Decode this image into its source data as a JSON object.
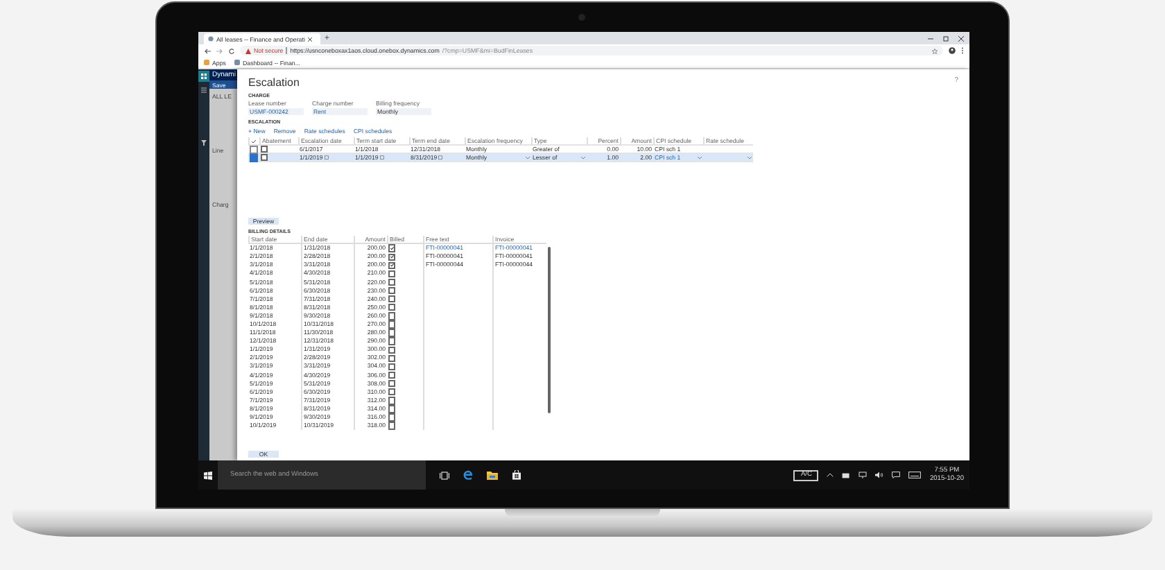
{
  "browser": {
    "tab_title": "All leases -- Finance and Operati",
    "new_tab": "+",
    "security": "Not secure",
    "url_host": "https://usnconeboxax1aos.cloud.onebox.dynamics.com",
    "url_path": "/?cmp=USMF&mi=BudFinLeases",
    "bookmarks": [
      "Apps",
      "Dashboard -- Finan..."
    ]
  },
  "app": {
    "brand": "Dynami",
    "save": "Save",
    "background_labels": [
      "ALL LE",
      "Line",
      "Charg"
    ]
  },
  "dialog": {
    "title": "Escalation",
    "help": "?",
    "charge_heading": "CHARGE",
    "fields": [
      {
        "label": "Lease number",
        "value": "USMF-000242"
      },
      {
        "label": "Charge number",
        "value": "Rent"
      },
      {
        "label": "Billing frequency",
        "value": "Monthly"
      }
    ],
    "escalation_heading": "ESCALATION",
    "actions": [
      "+ New",
      "Remove",
      "Rate schedules",
      "CPI schedules"
    ],
    "escalation_table": {
      "columns": [
        {
          "label": "Abatement",
          "kind": "check"
        },
        {
          "label": "Escalation date",
          "kind": "date"
        },
        {
          "label": "Term start date",
          "kind": "date"
        },
        {
          "label": "Term end date",
          "kind": "date"
        },
        {
          "label": "Escalation frequency",
          "kind": "choice"
        },
        {
          "label": "Type",
          "kind": "choice"
        },
        {
          "label": "Percent",
          "kind": "number"
        },
        {
          "label": "Amount",
          "kind": "number"
        },
        {
          "label": "CPI schedule",
          "kind": "choice"
        },
        {
          "label": "Rate schedule",
          "kind": "choice"
        }
      ],
      "rows": [
        {
          "selected": false,
          "abatement": false,
          "cells": [
            "",
            "6/1/2017",
            "1/1/2018",
            "12/31/2018",
            "Monthly",
            "Greater of",
            "0.00",
            "10.00",
            "CPI sch 1"
          ]
        },
        {
          "selected": true,
          "abatement": false,
          "cells": [
            "",
            "1/1/2019",
            "1/1/2019",
            "8/31/2019",
            "Monthly",
            "Lesser of",
            "1.00",
            "2.00",
            "CPI sch 1"
          ]
        }
      ]
    },
    "preview": "Preview",
    "billing_heading": "BILLING DETAILS",
    "billing_table": {
      "columns": [
        "Start date",
        "End date",
        "Amount",
        "Billed",
        "Free text",
        "Invoice"
      ],
      "rows": [
        {
          "cells": [
            "1/1/2018",
            "1/31/2018",
            "200.00"
          ],
          "billed": true,
          "free_text": "FTI-00000041",
          "invoice": "FTI-00000041"
        },
        {
          "cells": [
            "2/1/2018",
            "2/28/2018",
            "200.00"
          ],
          "billed": true,
          "free_text": "FTI-00000041",
          "invoice": "FTI-00000041"
        },
        {
          "cells": [
            "3/1/2018",
            "3/31/2018",
            "200.00"
          ],
          "billed": true,
          "free_text": "FTI-00000044",
          "invoice": "FTI-00000044"
        },
        {
          "cells": [
            "4/1/2018",
            "4/30/2018",
            "210.00"
          ],
          "billed": false
        },
        {
          "cells": [
            "5/1/2018",
            "5/31/2018",
            "220.00"
          ],
          "billed": false
        },
        {
          "cells": [
            "6/1/2018",
            "6/30/2018",
            "230.00"
          ],
          "billed": false
        },
        {
          "cells": [
            "7/1/2018",
            "7/31/2018",
            "240.00"
          ],
          "billed": false
        },
        {
          "cells": [
            "8/1/2018",
            "8/31/2018",
            "250.00"
          ],
          "billed": false
        },
        {
          "cells": [
            "9/1/2018",
            "9/30/2018",
            "260.00"
          ],
          "billed": false
        },
        {
          "cells": [
            "10/1/2018",
            "10/31/2018",
            "270.00"
          ],
          "billed": false
        },
        {
          "cells": [
            "11/1/2018",
            "11/30/2018",
            "280.00"
          ],
          "billed": false
        },
        {
          "cells": [
            "12/1/2018",
            "12/31/2018",
            "290.00"
          ],
          "billed": false
        },
        {
          "cells": [
            "1/1/2019",
            "1/31/2019",
            "300.00"
          ],
          "billed": false
        },
        {
          "cells": [
            "2/1/2019",
            "2/28/2019",
            "302.00"
          ],
          "billed": false
        },
        {
          "cells": [
            "3/1/2019",
            "3/31/2019",
            "304.00"
          ],
          "billed": false
        },
        {
          "cells": [
            "4/1/2019",
            "4/30/2019",
            "306.00"
          ],
          "billed": false
        },
        {
          "cells": [
            "5/1/2019",
            "5/31/2019",
            "308.00"
          ],
          "billed": false
        },
        {
          "cells": [
            "6/1/2019",
            "6/30/2019",
            "310.00"
          ],
          "billed": false
        },
        {
          "cells": [
            "7/1/2019",
            "7/31/2019",
            "312.00"
          ],
          "billed": false
        },
        {
          "cells": [
            "8/1/2019",
            "8/31/2019",
            "314.00"
          ],
          "billed": false
        },
        {
          "cells": [
            "9/1/2019",
            "9/30/2019",
            "316.00"
          ],
          "billed": false
        },
        {
          "cells": [
            "10/1/2019",
            "10/31/2019",
            "318.00"
          ],
          "billed": false
        }
      ]
    },
    "ok": "OK"
  },
  "taskbar": {
    "search": "Search the web and Windows",
    "ac": "A/C",
    "time": "7:55 PM",
    "date": "2015-10-20"
  }
}
